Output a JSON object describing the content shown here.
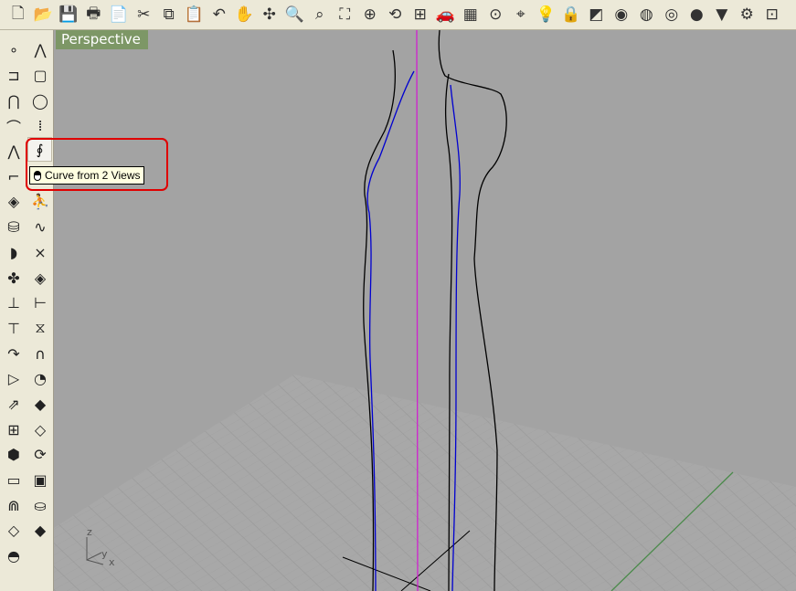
{
  "viewport": {
    "title": "Perspective",
    "axis_labels": {
      "z": "z",
      "y": "y",
      "x": "x"
    }
  },
  "tooltip": {
    "text": "Curve from 2 Views",
    "icon": "mouse-icon"
  },
  "top_toolbar": [
    {
      "name": "new-icon",
      "glyph": "🗋"
    },
    {
      "name": "open-icon",
      "glyph": "📂"
    },
    {
      "name": "save-icon",
      "glyph": "💾"
    },
    {
      "name": "print-icon",
      "glyph": "🖶"
    },
    {
      "name": "export-icon",
      "glyph": "📄"
    },
    {
      "name": "cut-icon",
      "glyph": "✂"
    },
    {
      "name": "copy-icon",
      "glyph": "⧉"
    },
    {
      "name": "paste-icon",
      "glyph": "📋"
    },
    {
      "name": "undo-icon",
      "glyph": "↶"
    },
    {
      "name": "pan-icon",
      "glyph": "✋"
    },
    {
      "name": "rotate-view-icon",
      "glyph": "✣"
    },
    {
      "name": "zoom-icon",
      "glyph": "🔍"
    },
    {
      "name": "zoom-window-icon",
      "glyph": "⌕"
    },
    {
      "name": "zoom-extents-icon",
      "glyph": "⛶"
    },
    {
      "name": "zoom-selected-icon",
      "glyph": "⊕"
    },
    {
      "name": "undo-view-icon",
      "glyph": "⟲"
    },
    {
      "name": "four-viewports-icon",
      "glyph": "⊞"
    },
    {
      "name": "car-icon",
      "glyph": "🚗"
    },
    {
      "name": "grid-icon",
      "glyph": "▦"
    },
    {
      "name": "osnap-icon",
      "glyph": "⊙"
    },
    {
      "name": "cplane-icon",
      "glyph": "⌖"
    },
    {
      "name": "light-icon",
      "glyph": "💡"
    },
    {
      "name": "lock-icon",
      "glyph": "🔒"
    },
    {
      "name": "layer-icon",
      "glyph": "◩"
    },
    {
      "name": "color-wheel-icon",
      "glyph": "◉"
    },
    {
      "name": "wireframe-icon",
      "glyph": "◍"
    },
    {
      "name": "shaded-icon",
      "glyph": "◎"
    },
    {
      "name": "render-icon",
      "glyph": "●"
    },
    {
      "name": "properties-icon",
      "glyph": "▼"
    },
    {
      "name": "options-icon",
      "glyph": "⚙"
    },
    {
      "name": "more-icon",
      "glyph": "⊡"
    }
  ],
  "left_toolbar_col1": [
    {
      "name": "point-icon",
      "glyph": "∘"
    },
    {
      "name": "polyline-icon",
      "glyph": "⊐"
    },
    {
      "name": "curve-icon",
      "glyph": "⋂"
    },
    {
      "name": "arc-icon",
      "glyph": "⌒"
    },
    {
      "name": "curve-edit-icon",
      "glyph": "⋀"
    },
    {
      "name": "fillet-curve-icon",
      "glyph": "⌐"
    },
    {
      "name": "surface-icon",
      "glyph": "◈"
    },
    {
      "name": "solid-cylinder-icon",
      "glyph": "⛁"
    },
    {
      "name": "sweep-icon",
      "glyph": "◗"
    },
    {
      "name": "transform-icon",
      "glyph": "✤"
    },
    {
      "name": "trim-icon",
      "glyph": "⊥"
    },
    {
      "name": "split-icon",
      "glyph": "⊤"
    },
    {
      "name": "offset-icon",
      "glyph": "↷"
    },
    {
      "name": "mirror-icon",
      "glyph": "▷"
    },
    {
      "name": "move-icon",
      "glyph": "⇗"
    },
    {
      "name": "array-icon",
      "glyph": "⊞"
    },
    {
      "name": "box-icon",
      "glyph": "⬢"
    },
    {
      "name": "dimension-icon",
      "glyph": "▭"
    },
    {
      "name": "analyze-icon",
      "glyph": "⋒"
    },
    {
      "name": "render-mesh-icon",
      "glyph": "◇"
    },
    {
      "name": "zebra-icon",
      "glyph": "◓"
    }
  ],
  "left_toolbar_col2": [
    {
      "name": "control-point-curve-icon",
      "glyph": "⋀"
    },
    {
      "name": "rectangle-icon",
      "glyph": "▢"
    },
    {
      "name": "circle-icon",
      "glyph": "◯"
    },
    {
      "name": "blend-curve-icon",
      "glyph": "⁞"
    },
    {
      "name": "curve-from-2-views-icon",
      "glyph": "∮"
    },
    {
      "name": "arc-tool-icon",
      "glyph": "⌒"
    },
    {
      "name": "person-icon",
      "glyph": "⛹"
    },
    {
      "name": "interp-curve-icon",
      "glyph": "∿"
    },
    {
      "name": "delete-point-icon",
      "glyph": "⨯"
    },
    {
      "name": "plane-icon",
      "glyph": "◈"
    },
    {
      "name": "scale-icon",
      "glyph": "⊢"
    },
    {
      "name": "symmetry-icon",
      "glyph": "⧖"
    },
    {
      "name": "arch-icon",
      "glyph": "∩"
    },
    {
      "name": "patch-icon",
      "glyph": "◔"
    },
    {
      "name": "plane-surface-icon",
      "glyph": "◆"
    },
    {
      "name": "flat-icon",
      "glyph": "◇"
    },
    {
      "name": "rotate-icon",
      "glyph": "⟳"
    },
    {
      "name": "frame-icon",
      "glyph": "▣"
    },
    {
      "name": "cylinder-icon",
      "glyph": "⛀"
    },
    {
      "name": "diamond-icon",
      "glyph": "◆"
    }
  ],
  "colors": {
    "viewport_bg": "#a3a3a3",
    "title_bg": "#7d9766",
    "highlight": "#e00000",
    "curve_blue": "#0000d0",
    "curve_magenta": "#d020d0",
    "axis_green": "#4a8a4a"
  }
}
